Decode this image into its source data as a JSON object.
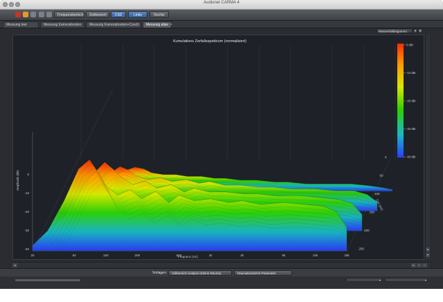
{
  "window": {
    "title": "Audionet CARMA 4",
    "colors": {
      "chrome": "#2a2c31",
      "plot_bg": "#1e2127",
      "accent_button": "#3f6fae"
    }
  },
  "toolbar": {
    "icons": [
      "record-icon",
      "undo-icon",
      "redo-icon",
      "settings-icon",
      "help-icon"
    ],
    "buttons": [
      {
        "label": "Frequenzbereich",
        "active": false
      },
      {
        "label": "Zeitbereich",
        "active": false
      },
      {
        "label": "CSD",
        "active": true
      },
      {
        "label": "Links",
        "active": false
      },
      {
        "label": "Rechts",
        "active": false
      }
    ]
  },
  "tabs": [
    {
      "label": "Messung leer",
      "active": false
    },
    {
      "label": "Messung Kamerabooten",
      "active": false
    },
    {
      "label": "Messung Kamerabooten+Couch",
      "active": false
    },
    {
      "label": "Messung alias",
      "active": true,
      "close": "×"
    }
  ],
  "view_selector": {
    "value": "Wasserfalldiagramm"
  },
  "chart_data": {
    "type": "area",
    "title": "Kumulatives Zerfallsspektrum (normalisiert)",
    "xlabel": "Frequenz (Hz)",
    "ylabel": "Amplitude (dB)",
    "zlabel": "Zeit (ms)",
    "x_scale": "log",
    "xlim": [
      20,
      20000
    ],
    "x_ticks": [
      "20",
      "50",
      "100",
      "200",
      "500",
      "1k",
      "2k",
      "5k",
      "10k",
      "20k"
    ],
    "y_ticks": [
      "0",
      "-10",
      "-20",
      "-30",
      "-40"
    ],
    "z_ticks": [
      "0",
      "50",
      "100",
      "150",
      "200",
      "250"
    ],
    "colorbar": {
      "labels": [
        "0 dBr",
        "-10 dBr",
        "-20 dBr",
        "-30 dBr",
        "-40 dBr"
      ],
      "colors": [
        "#ff2a0a",
        "#ff9a00",
        "#d8e800",
        "#2ed000",
        "#18b8c8",
        "#2a3cff"
      ]
    },
    "series": [
      {
        "values": [
          [
            20,
            -46
          ],
          [
            28,
            -38
          ],
          [
            40,
            -22
          ],
          [
            55,
            -5
          ],
          [
            70,
            0
          ],
          [
            85,
            -7
          ],
          [
            100,
            -14
          ],
          [
            130,
            -19
          ],
          [
            170,
            -16
          ],
          [
            220,
            -21
          ],
          [
            300,
            -17
          ],
          [
            400,
            -23
          ],
          [
            500,
            -19
          ],
          [
            700,
            -22
          ],
          [
            1000,
            -21
          ],
          [
            1500,
            -23
          ],
          [
            2000,
            -22
          ],
          [
            3000,
            -24
          ],
          [
            5000,
            -23
          ],
          [
            8000,
            -24
          ],
          [
            12000,
            -25
          ],
          [
            16000,
            -28
          ],
          [
            20000,
            -36
          ]
        ]
      },
      {
        "values": [
          [
            20,
            -48
          ],
          [
            28,
            -42
          ],
          [
            40,
            -30
          ],
          [
            55,
            -18
          ],
          [
            70,
            -12
          ],
          [
            85,
            -16
          ],
          [
            100,
            -20
          ],
          [
            130,
            -24
          ],
          [
            170,
            -22
          ],
          [
            220,
            -26
          ],
          [
            300,
            -24
          ],
          [
            400,
            -28
          ],
          [
            500,
            -26
          ],
          [
            700,
            -28
          ],
          [
            1000,
            -28
          ],
          [
            1500,
            -29
          ],
          [
            2000,
            -29
          ],
          [
            3000,
            -30
          ],
          [
            5000,
            -30
          ],
          [
            8000,
            -31
          ],
          [
            12000,
            -32
          ],
          [
            16000,
            -34
          ],
          [
            20000,
            -40
          ]
        ]
      },
      {
        "values": [
          [
            20,
            -50
          ],
          [
            28,
            -46
          ],
          [
            40,
            -37
          ],
          [
            55,
            -29
          ],
          [
            70,
            -25
          ],
          [
            85,
            -27
          ],
          [
            100,
            -30
          ],
          [
            130,
            -32
          ],
          [
            170,
            -31
          ],
          [
            220,
            -33
          ],
          [
            300,
            -32
          ],
          [
            400,
            -34
          ],
          [
            500,
            -33
          ],
          [
            700,
            -35
          ],
          [
            1000,
            -35
          ],
          [
            1500,
            -36
          ],
          [
            2000,
            -36
          ],
          [
            3000,
            -37
          ],
          [
            5000,
            -37
          ],
          [
            8000,
            -38
          ],
          [
            12000,
            -38
          ],
          [
            16000,
            -40
          ],
          [
            20000,
            -44
          ]
        ]
      },
      {
        "values": [
          [
            20,
            -52
          ],
          [
            28,
            -49
          ],
          [
            40,
            -43
          ],
          [
            55,
            -38
          ],
          [
            70,
            -36
          ],
          [
            85,
            -37
          ],
          [
            100,
            -39
          ],
          [
            130,
            -40
          ],
          [
            170,
            -40
          ],
          [
            220,
            -41
          ],
          [
            300,
            -41
          ],
          [
            400,
            -42
          ],
          [
            500,
            -42
          ],
          [
            700,
            -43
          ],
          [
            1000,
            -43
          ],
          [
            1500,
            -44
          ],
          [
            2000,
            -44
          ],
          [
            3000,
            -45
          ],
          [
            5000,
            -45
          ],
          [
            8000,
            -45
          ],
          [
            12000,
            -46
          ],
          [
            16000,
            -47
          ],
          [
            20000,
            -48
          ]
        ]
      }
    ]
  },
  "bottom": {
    "label": "Vorlagen:",
    "select1": "Vollbereich Analyse (Kleine Räume)",
    "select2": "Raumakustische Parameter (Tabelle)"
  }
}
